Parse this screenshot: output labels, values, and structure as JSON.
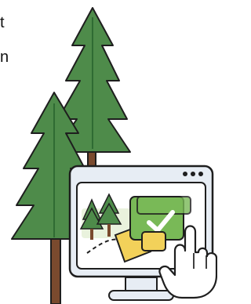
{
  "fragment_text": {
    "line_1": "t",
    "line_2": "n"
  },
  "colors": {
    "tree_green": "#4E8B4A",
    "tree_dark_green": "#2F6B33",
    "trunk_brown": "#7A4A2E",
    "monitor_frame": "#E7EDF4",
    "screen_bg": "#FFFFFF",
    "card_green": "#79B957",
    "card_yellow": "#F2D15A",
    "check_white": "#FFFFFF",
    "outline": "#1E1E1E"
  },
  "icons": {
    "tall_tree": "tree-icon",
    "short_tree": "tree-icon",
    "monitor": "monitor-icon",
    "checkmark": "checkmark-icon",
    "pointer_hand": "hand-pointer-icon",
    "map_marker": "map-marker-icon"
  }
}
